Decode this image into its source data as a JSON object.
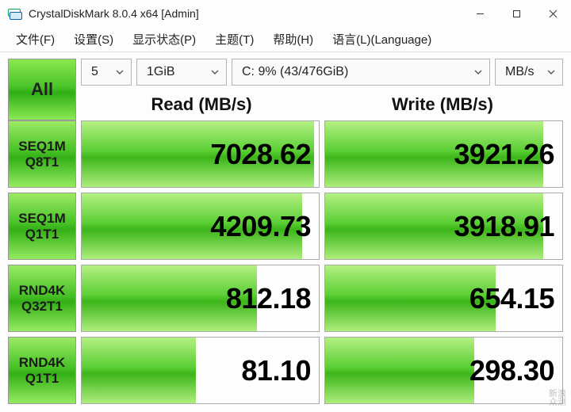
{
  "window": {
    "title": "CrystalDiskMark 8.0.4 x64 [Admin]"
  },
  "menu": {
    "file": "文件(F)",
    "settings": "设置(S)",
    "profile": "显示状态(P)",
    "theme": "主题(T)",
    "help": "帮助(H)",
    "language": "语言(L)(Language)"
  },
  "controls": {
    "all_label": "All",
    "runs": "5",
    "size": "1GiB",
    "drive": "C: 9% (43/476GiB)",
    "unit": "MB/s"
  },
  "headers": {
    "read": "Read (MB/s)",
    "write": "Write (MB/s)"
  },
  "rows": [
    {
      "l1": "SEQ1M",
      "l2": "Q8T1",
      "read": "7028.62",
      "read_pct": 98,
      "write": "3921.26",
      "write_pct": 92
    },
    {
      "l1": "SEQ1M",
      "l2": "Q1T1",
      "read": "4209.73",
      "read_pct": 93,
      "write": "3918.91",
      "write_pct": 92
    },
    {
      "l1": "RND4K",
      "l2": "Q32T1",
      "read": "812.18",
      "read_pct": 74,
      "write": "654.15",
      "write_pct": 72
    },
    {
      "l1": "RND4K",
      "l2": "Q1T1",
      "read": "81.10",
      "read_pct": 48,
      "write": "298.30",
      "write_pct": 63
    }
  ],
  "watermark": {
    "l1": "新浪",
    "l2": "众测"
  }
}
